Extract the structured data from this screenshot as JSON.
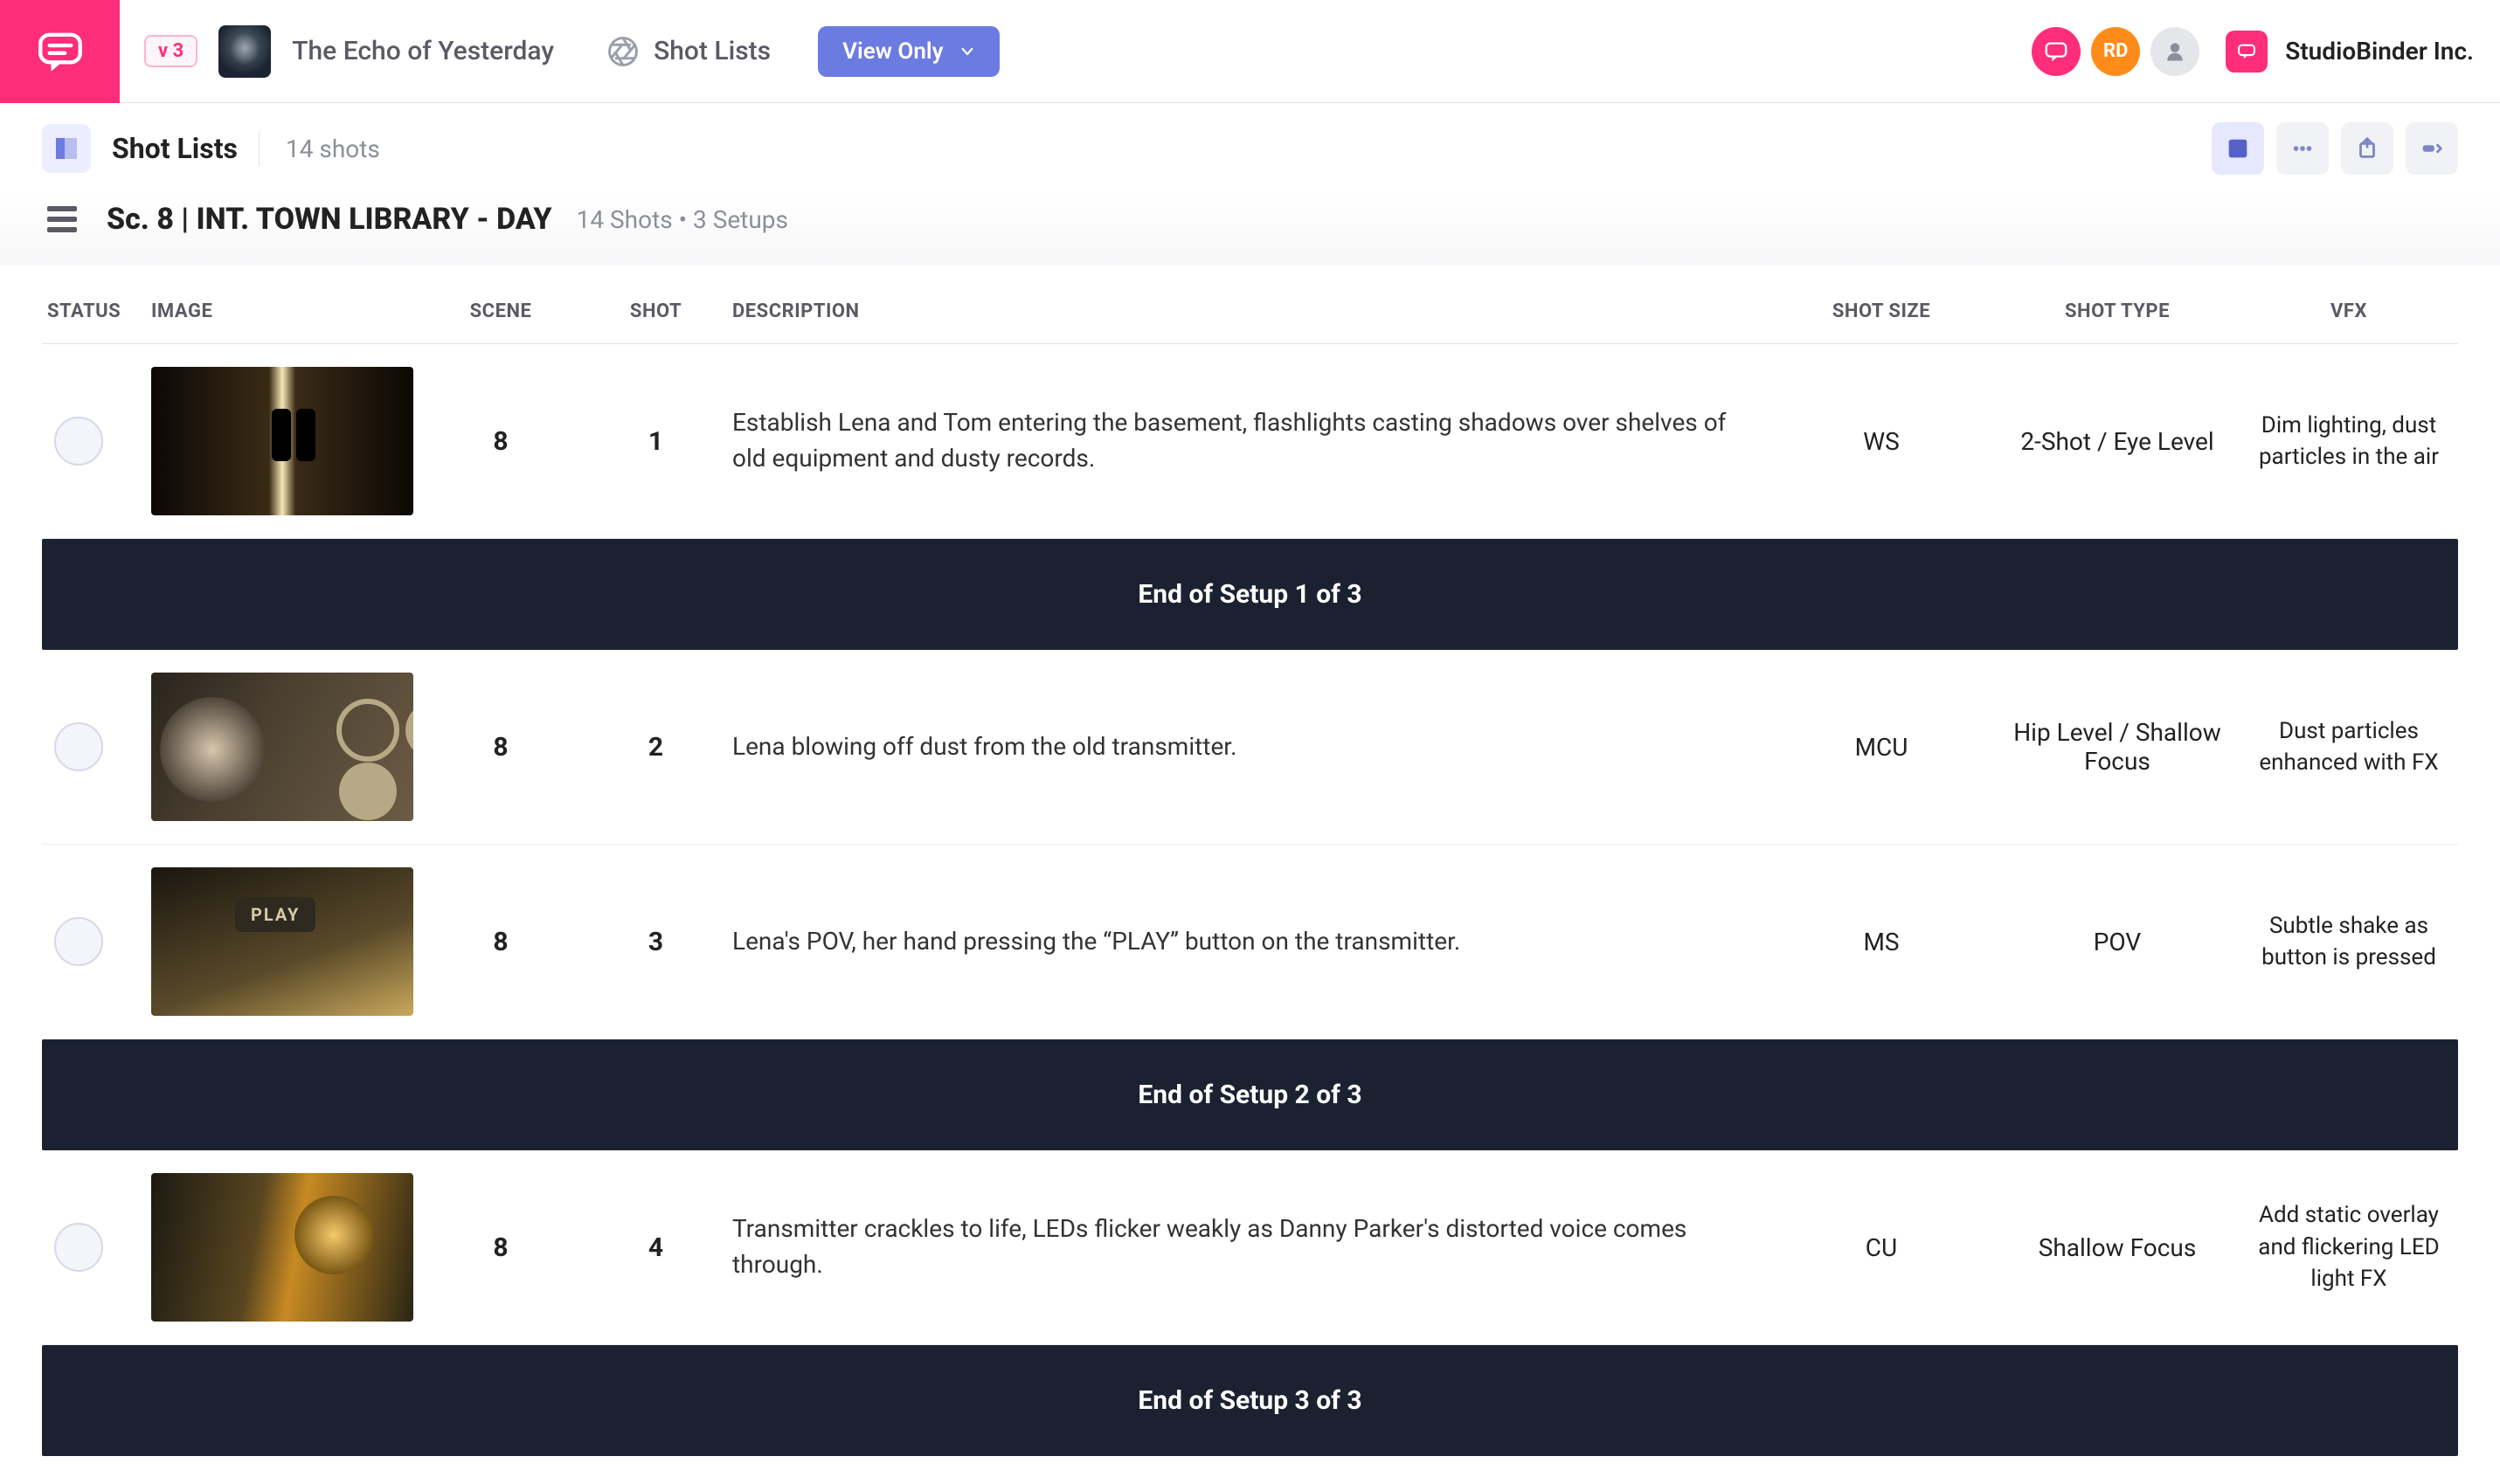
{
  "brand": {
    "org_name": "StudioBinder Inc."
  },
  "header": {
    "version_badge": "v 3",
    "project_title": "The Echo of Yesterday",
    "section_label": "Shot Lists",
    "view_mode_label": "View Only",
    "avatars": [
      {
        "kind": "icon",
        "name": "chat-icon"
      },
      {
        "kind": "initials",
        "text": "RD"
      },
      {
        "kind": "icon",
        "name": "person-icon"
      }
    ]
  },
  "subbar": {
    "title": "Shot Lists",
    "shot_count_label": "14 shots",
    "tools": [
      {
        "name": "layout-card-icon",
        "active": true
      },
      {
        "name": "more-icon",
        "active": false
      },
      {
        "name": "export-icon",
        "active": false
      },
      {
        "name": "color-filter-icon",
        "active": false
      }
    ]
  },
  "scene": {
    "title": "Sc. 8 | INT. TOWN LIBRARY - DAY",
    "meta": "14 Shots • 3 Setups"
  },
  "columns": {
    "status": "STATUS",
    "image": "IMAGE",
    "scene": "SCENE",
    "shot": "SHOT",
    "description": "DESCRIPTION",
    "shot_size": "SHOT SIZE",
    "shot_type": "SHOT TYPE",
    "vfx": "VFX"
  },
  "rows": [
    {
      "kind": "shot",
      "thumb_class": "t1",
      "scene": "8",
      "shot": "1",
      "description": "Establish Lena and Tom entering the basement, flashlights casting shadows over shelves of old equipment and dusty records.",
      "shot_size": "WS",
      "shot_type": "2-Shot / Eye Level",
      "vfx": "Dim lighting, dust particles in the air"
    },
    {
      "kind": "banner",
      "text": "End of  Setup 1 of 3"
    },
    {
      "kind": "shot",
      "thumb_class": "t2",
      "scene": "8",
      "shot": "2",
      "description": "Lena blowing off dust from the old transmitter.",
      "shot_size": "MCU",
      "shot_type": "Hip Level / Shallow Focus",
      "vfx": "Dust particles enhanced with FX"
    },
    {
      "kind": "shot",
      "thumb_class": "t3",
      "scene": "8",
      "shot": "3",
      "description": "Lena's POV, her hand pressing the “PLAY” button on the transmitter.",
      "shot_size": "MS",
      "shot_type": "POV",
      "vfx": "Subtle shake as button is pressed"
    },
    {
      "kind": "banner",
      "text": "End of  Setup 2 of 3"
    },
    {
      "kind": "shot",
      "thumb_class": "t4",
      "scene": "8",
      "shot": "4",
      "description": "Transmitter crackles to life, LEDs flicker weakly as Danny Parker's distorted voice comes through.",
      "shot_size": "CU",
      "shot_type": "Shallow Focus",
      "vfx": "Add static overlay and flickering LED light FX"
    },
    {
      "kind": "banner",
      "text": "End of  Setup 3 of 3"
    }
  ]
}
